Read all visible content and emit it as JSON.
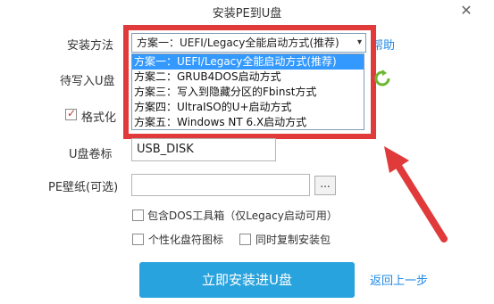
{
  "window": {
    "title": "安装PE到U盘",
    "close_glyph": "✕"
  },
  "form": {
    "method_label": "安装方法",
    "selected_method": "方案一：UEFI/Legacy全能启动方式(推荐)",
    "help_link": "帮助",
    "target_label": "待写入U盘",
    "format_label": "格式化",
    "format_checked": true,
    "volume_label": "U盘卷标",
    "volume_value": "USB_DISK",
    "wallpaper_label": "PE壁纸(可选)",
    "wallpaper_value": "",
    "browse_label": "...",
    "dos_option": "包含DOS工具箱（仅Legacy启动可用）",
    "custom_icon_option": "个性化盘符图标",
    "copy_installer_option": "同时复制安装包"
  },
  "dropdown": {
    "options": [
      "方案一：UEFI/Legacy全能启动方式(推荐)",
      "方案二：GRUB4DOS启动方式",
      "方案三：写入到隐藏分区的Fbinst方式",
      "方案四：UltraISO的U+启动方式",
      "方案五：Windows NT 6.X启动方式"
    ],
    "selected_index": 0
  },
  "actions": {
    "install_button": "立即安装进U盘",
    "back_link": "返回上一步"
  },
  "colors": {
    "highlight_red": "#e03a3a",
    "primary_blue": "#29a3dd",
    "link_blue": "#1e88e5",
    "selection_blue": "#3399ff",
    "refresh_green": "#6bb82e"
  }
}
